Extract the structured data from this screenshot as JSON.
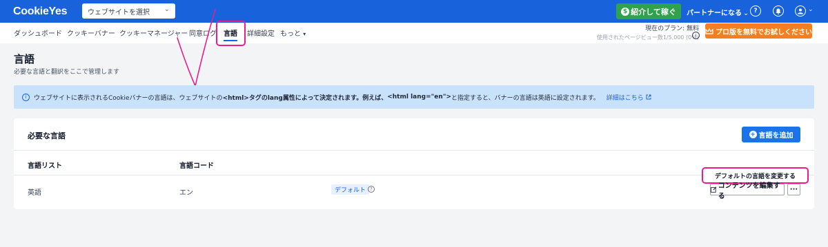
{
  "topbar": {
    "logo": "CookieYes",
    "site_select": "ウェブサイトを選択",
    "refer_label": "紹介して稼ぐ",
    "partner_label": "パートナーになる",
    "help_icon": "question-circle-icon",
    "bell_icon": "bell-icon",
    "avatar_icon": "user-circle-icon"
  },
  "nav": {
    "tabs": [
      {
        "label": "ダッシュボード"
      },
      {
        "label": "クッキーバナー"
      },
      {
        "label": "クッキーマネージャー"
      },
      {
        "label": "同意ログ"
      },
      {
        "label": "言語"
      },
      {
        "label": "詳細設定"
      },
      {
        "label": "もっと"
      }
    ],
    "active_tab": "言語",
    "plan_line1": "現在のプラン: 無料",
    "plan_line2": "使用されたページビュー数1/5,000 (0%)",
    "trial_label": "プロ版を無料でお試しください"
  },
  "page": {
    "title": "言語",
    "subtitle": "必要な言語と翻訳をここで管理します"
  },
  "banner": {
    "text_before": "ウェブサイトに表示されるCookieバナーの言語は、ウェブサイトの",
    "text_bold": "<html>タグのlang属性によって決定されます。例えば、",
    "text_code": " <html lang=\"en\">",
    "text_after": "と指定すると、バナーの言語は英語に設定されます。",
    "link": "詳細はこちら"
  },
  "card": {
    "title": "必要な言語",
    "add_label": "言語を追加",
    "columns": [
      "言語リスト",
      "言語コード"
    ],
    "rows": [
      {
        "language": "英語",
        "code": "エン",
        "badge": "デフォルト"
      }
    ],
    "change_default_label": "デフォルトの言語を変更する",
    "edit_label": "コンテンツを編集する",
    "more_label": "···"
  },
  "colors": {
    "brand": "#1863dc",
    "refer": "#2fa34b",
    "trial": "#f47f20",
    "highlight": "#e91e8c"
  }
}
